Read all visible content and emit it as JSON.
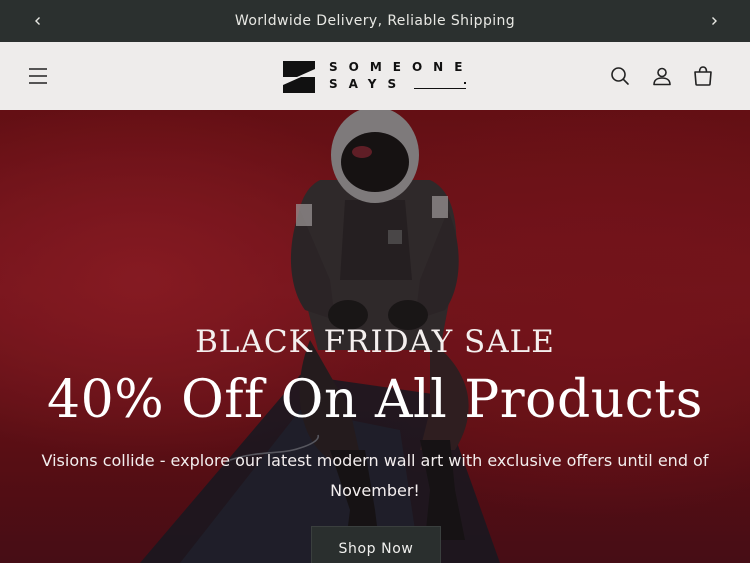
{
  "announcement": {
    "text": "Worldwide Delivery, Reliable Shipping",
    "prev_icon": "chevron-left-icon",
    "next_icon": "chevron-right-icon"
  },
  "header": {
    "menu_icon": "hamburger-menu-icon",
    "logo": {
      "line1": "SOMEONE",
      "line2": "SAYS"
    },
    "icons": [
      "search-icon",
      "account-icon",
      "cart-icon"
    ]
  },
  "hero": {
    "eyebrow": "BLACK FRIDAY SALE",
    "headline": "40% Off On All Products",
    "subtext": "Visions collide - explore our latest modern wall art with exclusive offers until end of November!",
    "cta_label": "Shop Now"
  },
  "colors": {
    "announcement_bg": "#2b302f",
    "header_bg": "#eeeceb",
    "hero_red": "#8c1a22",
    "button_bg": "#2a2f2e"
  }
}
